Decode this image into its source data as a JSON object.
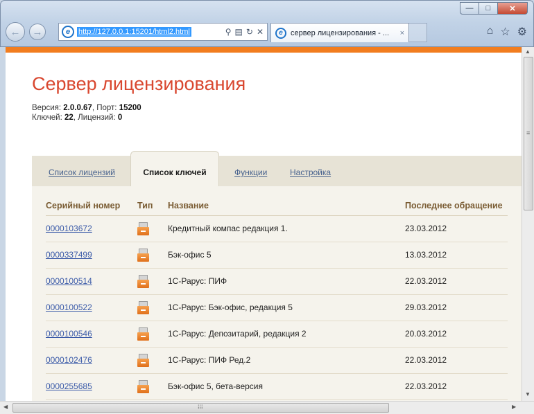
{
  "browser": {
    "url": "http://127.0.0.1:15201/html2.html",
    "tab_title": "сервер лицензирования - ...",
    "tab_close": "×",
    "back_icon": "back-arrow-icon",
    "forward_icon": "forward-arrow-icon"
  },
  "page": {
    "title": "Сервер лицензирования",
    "version_label": "Версия:",
    "version_value": "2.0.0.67",
    "port_label": ", Порт:",
    "port_value": "15200",
    "keys_label": "Ключей:",
    "keys_value": "22",
    "licenses_label": ", Лицензий:",
    "licenses_value": "0"
  },
  "tabs": {
    "licenses": "Список лицензий",
    "keys": "Список ключей",
    "functions": "Функции",
    "settings": "Настройка",
    "active": "keys"
  },
  "table": {
    "headers": {
      "serial": "Серийный номер",
      "type": "Тип",
      "name": "Название",
      "last_access": "Последнее обращение"
    },
    "rows": [
      {
        "serial": "0000103672",
        "name": "Кредитный компас редакция 1.",
        "date": "23.03.2012"
      },
      {
        "serial": "0000337499",
        "name": "Бэк-офис 5",
        "date": "13.03.2012"
      },
      {
        "serial": "0000100514",
        "name": "1С-Рарус: ПИФ",
        "date": "22.03.2012"
      },
      {
        "serial": "0000100522",
        "name": "1С-Рарус: Бэк-офис, редакция 5",
        "date": "29.03.2012"
      },
      {
        "serial": "0000100546",
        "name": "1С-Рарус: Депозитарий, редакция 2",
        "date": "20.03.2012"
      },
      {
        "serial": "0000102476",
        "name": "1С-Рарус: ПИФ Ред.2",
        "date": "22.03.2012"
      },
      {
        "serial": "0000255685",
        "name": "Бэк-офис 5, бета-версия",
        "date": "22.03.2012"
      }
    ]
  },
  "colors": {
    "accent_orange": "#f27d1f",
    "title_red": "#d9472f",
    "link_blue": "#3a5aa8"
  }
}
